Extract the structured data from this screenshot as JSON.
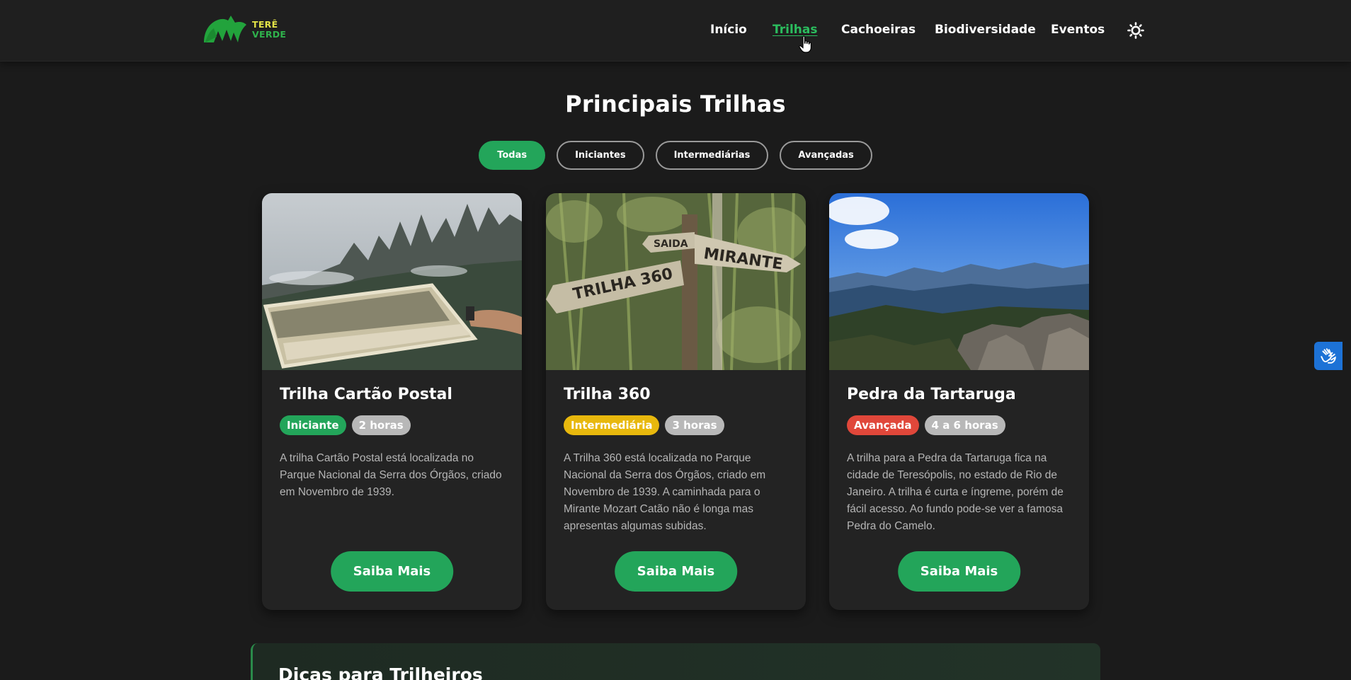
{
  "header": {
    "logo": {
      "line1": "TERÊ",
      "line2": "VERDE"
    },
    "nav": [
      {
        "label": "Início",
        "active": false
      },
      {
        "label": "Trilhas",
        "active": true
      },
      {
        "label": "Cachoeiras",
        "active": false
      },
      {
        "label": "Biodiversidade",
        "active": false
      },
      {
        "label": "Eventos",
        "active": false
      }
    ],
    "theme_icon": "sun-icon"
  },
  "main": {
    "title": "Principais Trilhas",
    "filters": [
      {
        "label": "Todas",
        "active": true
      },
      {
        "label": "Iniciantes",
        "active": false
      },
      {
        "label": "Intermediárias",
        "active": false
      },
      {
        "label": "Avançadas",
        "active": false
      }
    ],
    "cards": [
      {
        "title": "Trilha Cartão Postal",
        "level": "Iniciante",
        "level_color": "#23a55a",
        "duration": "2 horas",
        "description": "A trilha Cartão Postal está localizada no Parque Nacional da Serra dos Órgãos, criado em Novembro de 1939.",
        "button": "Saiba Mais"
      },
      {
        "title": "Trilha 360",
        "level": "Intermediária",
        "level_color": "#e8b80d",
        "duration": "3 horas",
        "description": "A Trilha 360 está localizada no Parque Nacional da Serra dos Órgãos, criado em Novembro de 1939. A caminhada para o Mirante Mozart Catão não é longa mas apresentas algumas subidas.",
        "button": "Saiba Mais"
      },
      {
        "title": "Pedra da Tartaruga",
        "level": "Avançada",
        "level_color": "#e0473a",
        "duration": "4 a 6 horas",
        "description": "A trilha para a Pedra da Tartaruga fica na cidade de Teresópolis, no estado de Rio de Janeiro. A trilha é curta e íngreme, porém de fácil acesso. Ao fundo pode-se ver a famosa Pedra do Camelo.",
        "button": "Saiba Mais"
      }
    ],
    "tips_title": "Dicas para Trilheiros"
  },
  "signs": {
    "saida": "SAIDA",
    "mirante": "MIRANTE",
    "trilha360": "TRILHA 360"
  },
  "colors": {
    "accent": "#23a55a",
    "background": "#1b1b1b",
    "card": "#232323",
    "duration_badge": "#b8b8b8"
  }
}
